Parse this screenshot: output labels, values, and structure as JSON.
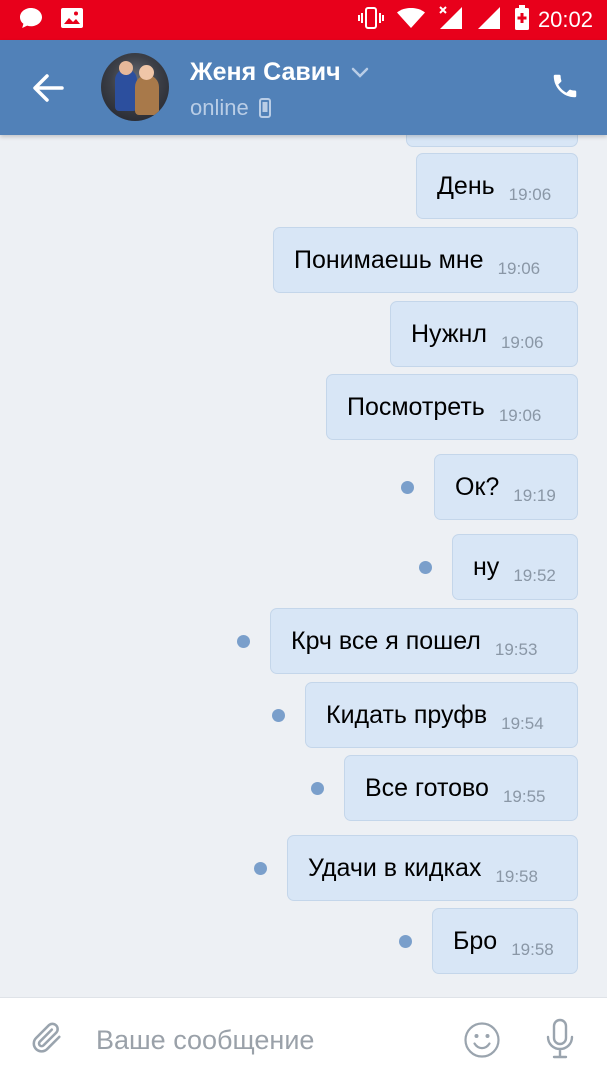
{
  "status_bar": {
    "time": "20:02"
  },
  "header": {
    "contact_name": "Женя Савич",
    "status": "online"
  },
  "messages": [
    {
      "text": "День",
      "time": "19:06",
      "unread": false
    },
    {
      "text": "Понимаешь мне",
      "time": "19:06",
      "unread": false
    },
    {
      "text": "Нужнл",
      "time": "19:06",
      "unread": false
    },
    {
      "text": "Посмотреть",
      "time": "19:06",
      "unread": false
    },
    {
      "text": "Ок?",
      "time": "19:19",
      "unread": true
    },
    {
      "text": "ну",
      "time": "19:52",
      "unread": true
    },
    {
      "text": "Крч все я пошел",
      "time": "19:53",
      "unread": true
    },
    {
      "text": "Кидать пруфв",
      "time": "19:54",
      "unread": true
    },
    {
      "text": "Все готово",
      "time": "19:55",
      "unread": true
    },
    {
      "text": "Удачи в кидках",
      "time": "19:58",
      "unread": true
    },
    {
      "text": "Бро",
      "time": "19:58",
      "unread": true
    }
  ],
  "composer": {
    "placeholder": "Ваше сообщение"
  },
  "icons": {
    "status_bar": [
      "message-notification-icon",
      "image-notification-icon",
      "vibrate-icon",
      "wifi-icon",
      "signal-no-data-icon",
      "signal-icon",
      "battery-charging-icon"
    ],
    "header": [
      "back-arrow-icon",
      "chevron-down-icon",
      "mobile-device-icon",
      "phone-icon"
    ],
    "composer": [
      "paperclip-icon",
      "emoji-icon",
      "microphone-icon"
    ]
  },
  "colors": {
    "status_bar": "#e8001b",
    "header": "#5181b8",
    "bubble_outgoing": "#d8e6f6",
    "unread_dot": "#7a9fcb",
    "chat_background": "#edf0f4"
  }
}
